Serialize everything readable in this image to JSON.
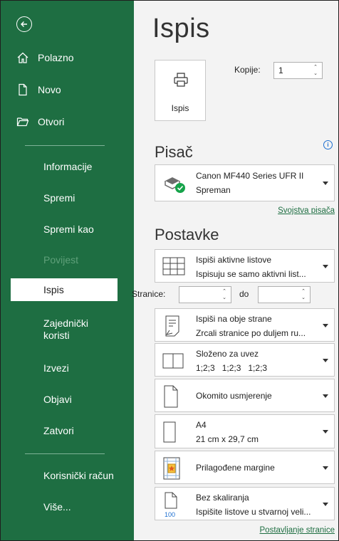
{
  "sidebar": {
    "items": [
      {
        "label": "Polazno",
        "icon": "home-icon"
      },
      {
        "label": "Novo",
        "icon": "new-document-icon"
      },
      {
        "label": "Otvori",
        "icon": "open-folder-icon"
      },
      {
        "label": "Informacije"
      },
      {
        "label": "Spremi"
      },
      {
        "label": "Spremi kao"
      },
      {
        "label": "Povijest",
        "disabled": true
      },
      {
        "label": "Ispis",
        "active": true
      },
      {
        "label": "Zajednički koristi"
      },
      {
        "label": "Izvezi"
      },
      {
        "label": "Objavi"
      },
      {
        "label": "Zatvori"
      },
      {
        "label": "Korisnički račun"
      },
      {
        "label": "Više..."
      }
    ],
    "bg_color": "#1e6e42"
  },
  "main": {
    "title": "Ispis",
    "print_button_label": "Ispis",
    "copies_label": "Kopije:",
    "copies_value": "1",
    "printer_section": "Pisač",
    "printer": {
      "name": "Canon MF440 Series UFR II",
      "status": "Spreman"
    },
    "printer_properties_link": "Svojstva pisača",
    "settings_section": "Postavke",
    "pages_label": "Stranice:",
    "pages_to_label": "do",
    "pages_from": "",
    "pages_to": "",
    "settings": [
      {
        "line1": "Ispiši aktivne listove",
        "line2": "Ispisuju se samo aktivni list...",
        "icon": "sheet-grid-icon"
      },
      {
        "line1": "Ispiši na obje strane",
        "line2": "Zrcali stranice po duljem ru...",
        "icon": "duplex-icon"
      },
      {
        "line1": "Složeno za uvez",
        "line2": "1;2;3   1;2;3   1;2;3",
        "icon": "collate-icon"
      },
      {
        "line1": "Okomito usmjerenje",
        "line2": "",
        "icon": "portrait-icon"
      },
      {
        "line1": "A4",
        "line2": "21 cm x 29,7 cm",
        "icon": "paper-size-icon"
      },
      {
        "line1": "Prilagođene margine",
        "line2": "",
        "icon": "margins-icon"
      },
      {
        "line1": "Bez skaliranja",
        "line2": "Ispišite listove u stvarnoj veli...",
        "icon": "no-scaling-icon",
        "badge": "100"
      }
    ],
    "page_setup_link": "Postavljanje stranice"
  }
}
